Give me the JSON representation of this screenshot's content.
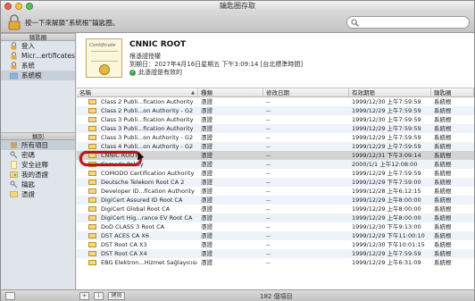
{
  "window": {
    "title": "鑰匙圈存取"
  },
  "toolbar": {
    "lock_hint": "按一下來解鎖“系統根”鑰匙圈。",
    "search_placeholder": ""
  },
  "sidebar": {
    "keychains_header": "鑰匙圈",
    "keychains": [
      {
        "label": "登入",
        "icon": "lock-icon",
        "selected": false
      },
      {
        "label": "Micr...ertificates",
        "icon": "lock-icon",
        "selected": false
      },
      {
        "label": "系統",
        "icon": "lock-icon",
        "selected": false
      },
      {
        "label": "系統根",
        "icon": "folder-icon",
        "selected": true
      }
    ],
    "category_header": "類別",
    "categories": [
      {
        "label": "所有項目",
        "icon": "all-items-icon",
        "selected": true
      },
      {
        "label": "密碼",
        "icon": "key-icon",
        "selected": false
      },
      {
        "label": "安全註釋",
        "icon": "note-icon",
        "selected": false
      },
      {
        "label": "我的憑證",
        "icon": "my-cert-icon",
        "selected": false
      },
      {
        "label": "鑰匙",
        "icon": "key-icon",
        "selected": false
      },
      {
        "label": "憑證",
        "icon": "certificate-icon",
        "selected": false
      }
    ]
  },
  "detail": {
    "cert_image_text": "Certificate",
    "name": "CNNIC ROOT",
    "type": "根憑證授權",
    "expires": "到期日：2027年4月16日星期五 下午3:09:14 [台北標準時間]",
    "validity": "此憑證是有效的",
    "valid_mark": "✓"
  },
  "table": {
    "columns": [
      "名稱",
      "種類",
      "修改日期",
      "有效期限",
      "鑰匙圈"
    ],
    "sort_indicator": "▲",
    "rows": [
      [
        "Class 2 Publi...fication Authority",
        "憑證",
        "--",
        "1999/12/30 上午7:59:59",
        "系統根"
      ],
      [
        "Class 2 Publi...on Authority - G2",
        "憑證",
        "--",
        "1999/12/29 上午7:59:59",
        "系統根"
      ],
      [
        "Class 3 Publi...fication Authority",
        "憑證",
        "--",
        "1999/12/30 上午7:59:59",
        "系統根"
      ],
      [
        "Class 3 Publi...fication Authority",
        "憑證",
        "--",
        "1999/12/29 上午7:59:59",
        "系統根"
      ],
      [
        "Class 3 Publi...on Authority - G2",
        "憑證",
        "--",
        "1999/12/29 上午7:59:59",
        "系統根"
      ],
      [
        "Class 4 Publi...on Authority - G2",
        "憑證",
        "--",
        "1999/12/29 上午7:59:59",
        "系統根"
      ],
      [
        "CNNIC ROOT",
        "憑證",
        "--",
        "1999/12/31 下午3:09:14",
        "系統根"
      ],
      [
        "Comodo Policy",
        "憑證",
        "--",
        "2000/1/1 上午12:08:00",
        "系統根"
      ],
      [
        "COMODO Certification Authority",
        "憑證",
        "--",
        "1999/12/29 上午7:59:59",
        "系統根"
      ],
      [
        "Deutsche Telekom Root CA 2",
        "憑證",
        "--",
        "1999/12/29 下午7:59:00",
        "系統根"
      ],
      [
        "Developer ID...fication Authority",
        "憑證",
        "--",
        "1999/12/28 上午6:12:15",
        "系統根"
      ],
      [
        "DigiCert Assured ID Root CA",
        "憑證",
        "--",
        "1999/12/29 上午8:00:00",
        "系統根"
      ],
      [
        "DigiCert Global Root CA",
        "憑證",
        "--",
        "1999/12/29 上午8:00:00",
        "系統根"
      ],
      [
        "DigiCert Hig...rance EV Root CA",
        "憑證",
        "--",
        "1999/12/29 上午8:00:00",
        "系統根"
      ],
      [
        "DoD CLASS 3 Root CA",
        "憑證",
        "--",
        "1999/12/30 下午9:13:00",
        "系統根"
      ],
      [
        "DST ACES CA X6",
        "憑證",
        "--",
        "1999/12/29 下午11:00:10",
        "系統根"
      ],
      [
        "DST Root CA X3",
        "憑證",
        "--",
        "1999/12/30 下午10:01:15",
        "系統根"
      ],
      [
        "DST Root CA X4",
        "憑證",
        "--",
        "1999/12/29 上午7:59:59",
        "系統根"
      ],
      [
        "EBG Elektron...Hizmet Sağlayıcısı",
        "憑證",
        "--",
        "1999/12/29 上午6:31:09",
        "系統根"
      ]
    ],
    "selected_row_index": 6
  },
  "status": {
    "add_button": "+",
    "info_button": "i",
    "copy_button": "拷貝",
    "item_count": "182 個項目"
  },
  "colors": {
    "highlight_ring": "#b8191b",
    "selection": "#d4d4d4",
    "valid_green": "#3aa64a"
  }
}
